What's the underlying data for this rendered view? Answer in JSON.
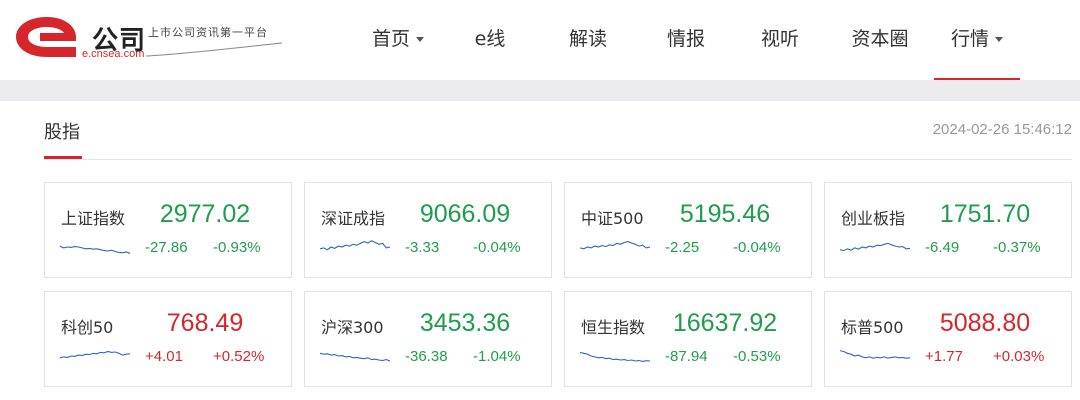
{
  "logo": {
    "name": "公司",
    "domain": "e.cnsea.com",
    "slogan": "上市公司资讯第一平台",
    "brand_color": "#d7262b"
  },
  "nav": {
    "items": [
      {
        "label": "首页",
        "dropdown": true
      },
      {
        "label": "e线",
        "dropdown": false
      },
      {
        "label": "解读",
        "dropdown": false
      },
      {
        "label": "情报",
        "dropdown": false
      },
      {
        "label": "视听",
        "dropdown": false
      },
      {
        "label": "资本圈",
        "dropdown": false
      },
      {
        "label": "行情",
        "dropdown": true,
        "active": true
      }
    ]
  },
  "section": {
    "title": "股指",
    "timestamp": "2024-02-26 15:46:12"
  },
  "colors": {
    "up": "#d7262b",
    "down": "#1e9e4a",
    "sparkline": "#2f63c8"
  },
  "indices": [
    {
      "name": "上证指数",
      "value": "2977.02",
      "change": "-27.86",
      "pct": "-0.93%",
      "direction": "down",
      "spark": [
        0.45,
        0.55,
        0.5,
        0.52,
        0.48,
        0.5,
        0.55,
        0.6,
        0.58,
        0.62,
        0.6,
        0.65,
        0.7,
        0.72,
        0.68,
        0.75,
        0.8,
        0.82,
        0.78,
        0.85
      ]
    },
    {
      "name": "深证成指",
      "value": "9066.09",
      "change": "-3.33",
      "pct": "-0.04%",
      "direction": "down",
      "spark": [
        0.6,
        0.55,
        0.65,
        0.5,
        0.58,
        0.45,
        0.5,
        0.4,
        0.45,
        0.35,
        0.4,
        0.3,
        0.2,
        0.28,
        0.15,
        0.25,
        0.35,
        0.3,
        0.55,
        0.5
      ]
    },
    {
      "name": "中证500",
      "value": "5195.46",
      "change": "-2.25",
      "pct": "-0.04%",
      "direction": "down",
      "spark": [
        0.55,
        0.6,
        0.5,
        0.55,
        0.45,
        0.5,
        0.42,
        0.48,
        0.38,
        0.42,
        0.3,
        0.35,
        0.25,
        0.2,
        0.28,
        0.35,
        0.45,
        0.4,
        0.55,
        0.5
      ]
    },
    {
      "name": "创业板指",
      "value": "1751.70",
      "change": "-6.49",
      "pct": "-0.37%",
      "direction": "down",
      "spark": [
        0.65,
        0.7,
        0.6,
        0.68,
        0.55,
        0.62,
        0.5,
        0.55,
        0.45,
        0.5,
        0.4,
        0.42,
        0.35,
        0.3,
        0.38,
        0.45,
        0.5,
        0.48,
        0.6,
        0.58
      ]
    },
    {
      "name": "科创50",
      "value": "768.49",
      "change": "+4.01",
      "pct": "+0.52%",
      "direction": "up",
      "spark": [
        0.6,
        0.55,
        0.58,
        0.5,
        0.52,
        0.45,
        0.48,
        0.4,
        0.42,
        0.35,
        0.38,
        0.3,
        0.32,
        0.25,
        0.3,
        0.28,
        0.35,
        0.45,
        0.4,
        0.38
      ]
    },
    {
      "name": "沪深300",
      "value": "3453.36",
      "change": "-36.38",
      "pct": "-1.04%",
      "direction": "down",
      "spark": [
        0.35,
        0.4,
        0.38,
        0.45,
        0.42,
        0.5,
        0.48,
        0.55,
        0.52,
        0.6,
        0.58,
        0.62,
        0.65,
        0.6,
        0.7,
        0.68,
        0.72,
        0.75,
        0.7,
        0.78
      ]
    },
    {
      "name": "恒生指数",
      "value": "16637.92",
      "change": "-87.94",
      "pct": "-0.53%",
      "direction": "down",
      "spark": [
        0.3,
        0.35,
        0.4,
        0.5,
        0.55,
        0.6,
        0.58,
        0.65,
        0.62,
        0.7,
        0.68,
        0.72,
        0.7,
        0.75,
        0.72,
        0.78,
        0.75,
        0.8,
        0.76,
        0.78
      ]
    },
    {
      "name": "标普500",
      "value": "5088.80",
      "change": "+1.77",
      "pct": "+0.03%",
      "direction": "up",
      "spark": [
        0.2,
        0.25,
        0.35,
        0.4,
        0.5,
        0.45,
        0.55,
        0.6,
        0.55,
        0.62,
        0.58,
        0.6,
        0.55,
        0.62,
        0.58,
        0.55,
        0.6,
        0.58,
        0.62,
        0.6
      ]
    }
  ]
}
